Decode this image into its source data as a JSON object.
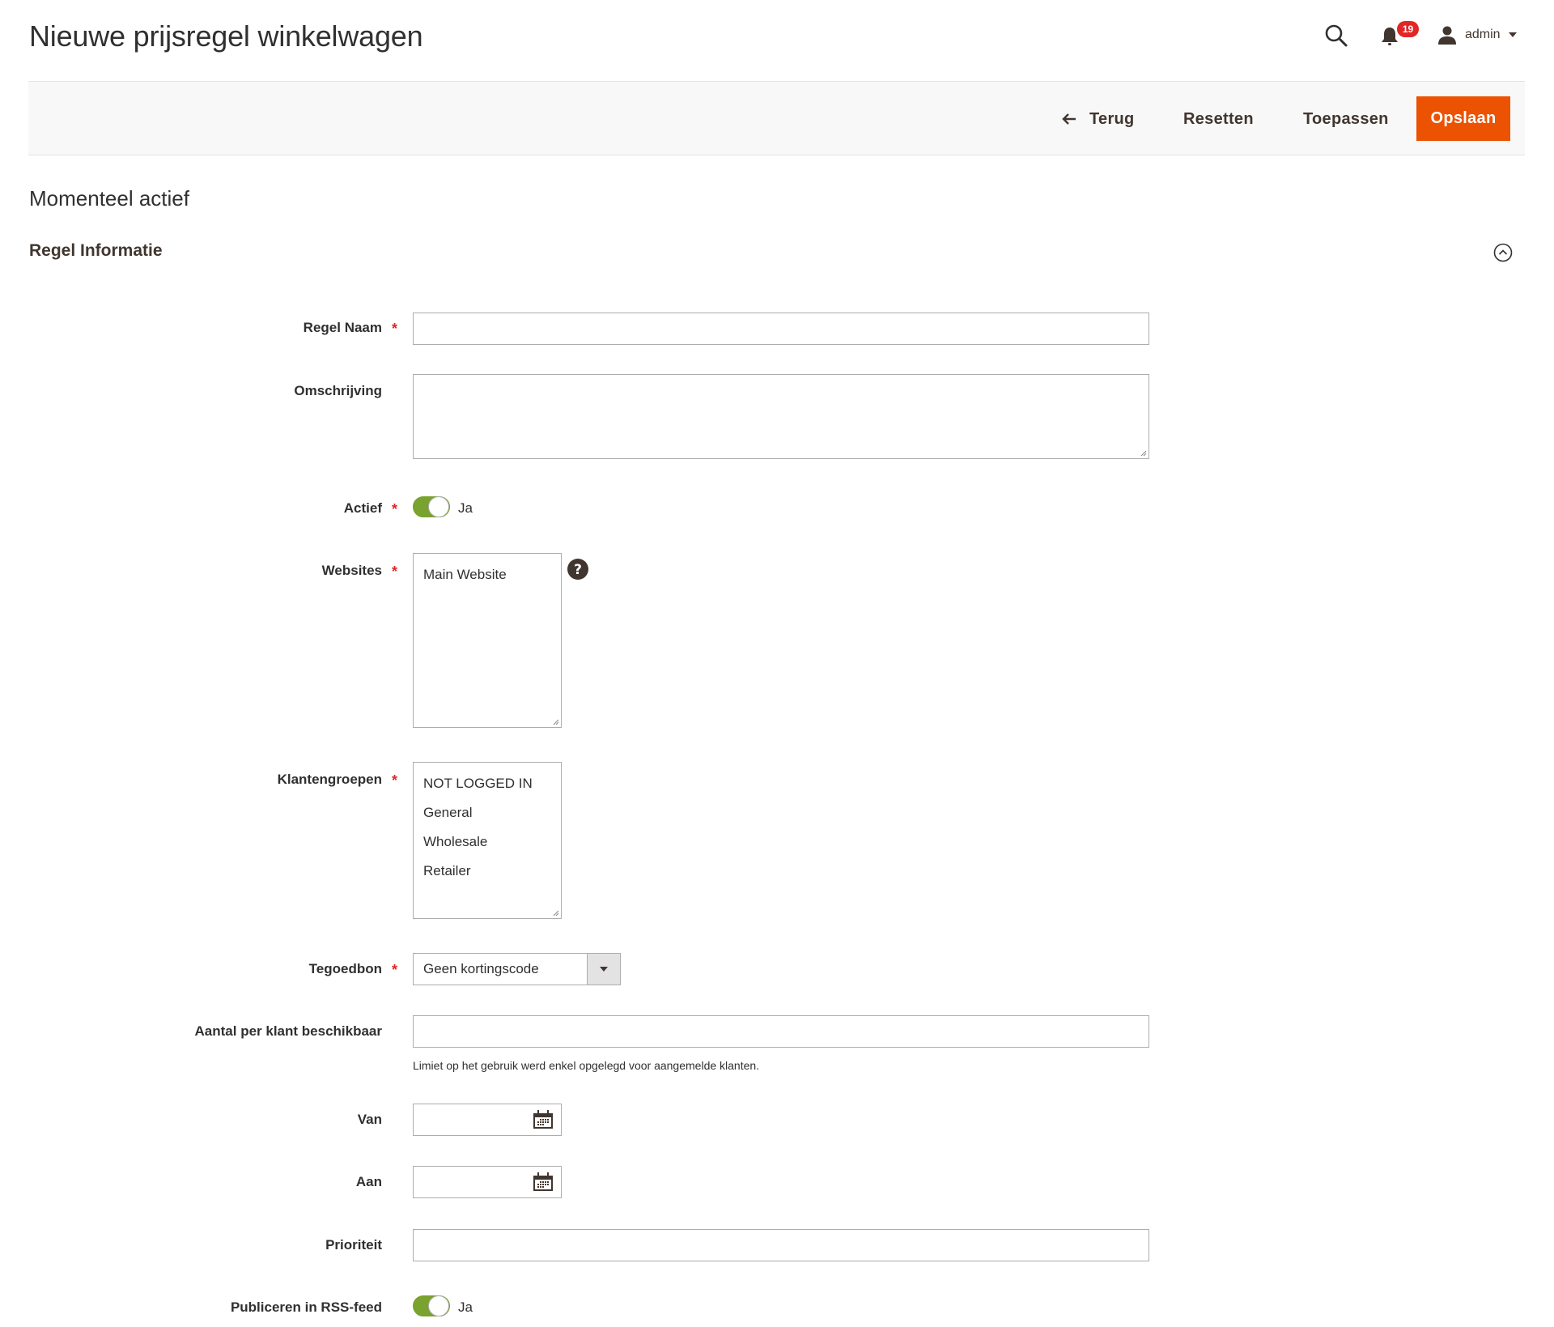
{
  "header": {
    "title": "Nieuwe prijsregel winkelwagen",
    "notifications_count": "19",
    "user_name": "admin",
    "icons": {
      "search": "search-icon",
      "notifications": "bell-icon",
      "user": "user-icon",
      "user_menu": "caret-down-icon"
    }
  },
  "toolbar": {
    "back_label": "Terug",
    "reset_label": "Resetten",
    "apply_label": "Toepassen",
    "save_label": "Opslaan",
    "save_color": "#eb5202"
  },
  "status": "Momenteel actief",
  "section": {
    "title": "Regel Informatie",
    "collapse_icon": "chevron-up-circle-icon"
  },
  "form": {
    "rule_name": {
      "label": "Regel Naam",
      "required": true,
      "value": ""
    },
    "description": {
      "label": "Omschrijving",
      "required": false,
      "value": ""
    },
    "active": {
      "label": "Actief",
      "required": true,
      "value": true,
      "value_label": "Ja",
      "color": "#79a22e"
    },
    "websites": {
      "label": "Websites",
      "required": true,
      "options": [
        "Main Website"
      ],
      "selected": []
    },
    "customer_groups": {
      "label": "Klantengroepen",
      "required": true,
      "options": [
        "NOT LOGGED IN",
        "General",
        "Wholesale",
        "Retailer"
      ],
      "selected": []
    },
    "coupon": {
      "label": "Tegoedbon",
      "required": true,
      "value": "Geen kortingscode"
    },
    "uses_per_customer": {
      "label": "Aantal per klant beschikbaar",
      "required": false,
      "value": "",
      "note": "Limiet op het gebruik werd enkel opgelegd voor aangemelde klanten."
    },
    "from_date": {
      "label": "Van",
      "value": ""
    },
    "to_date": {
      "label": "Aan",
      "value": ""
    },
    "priority": {
      "label": "Prioriteit",
      "value": ""
    },
    "rss": {
      "label": "Publiceren in RSS-feed",
      "value": true,
      "value_label": "Ja"
    },
    "required_marker": "*"
  }
}
